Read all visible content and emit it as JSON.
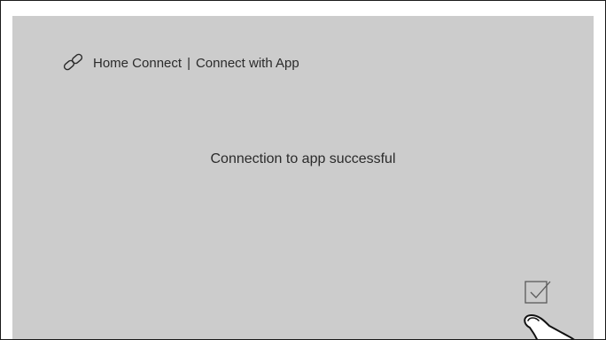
{
  "header": {
    "icon": "link-icon",
    "title": "Home Connect",
    "separator": "|",
    "subtitle": "Connect with App"
  },
  "main": {
    "message": "Connection to app successful"
  },
  "actions": {
    "confirm_icon": "checkbox-check-icon"
  },
  "overlay": {
    "pointer_icon": "tapping-hand-icon"
  },
  "colors": {
    "screen_background": "#cccccc",
    "text": "#2b2b2b",
    "frame": "#1a1a1a"
  }
}
